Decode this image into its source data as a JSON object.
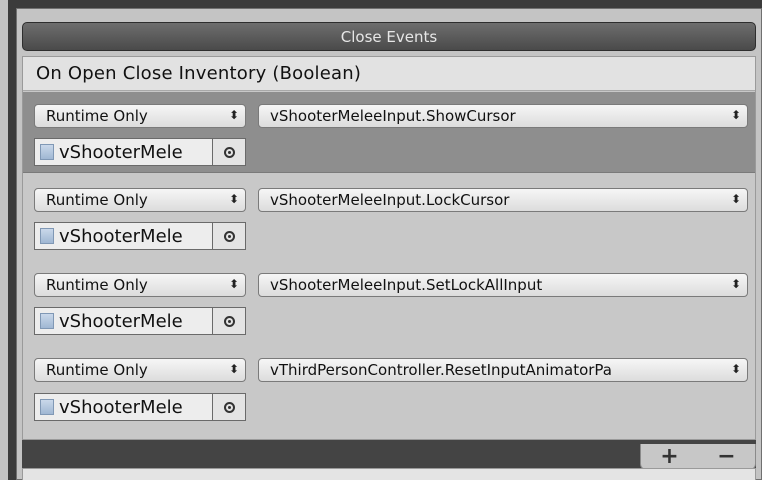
{
  "header": {
    "title": "Close Events"
  },
  "event": {
    "title": "On Open Close Inventory (Boolean)",
    "listeners": [
      {
        "mode": "Runtime Only",
        "function": "vShooterMeleeInput.ShowCursor",
        "target": "vShooterMele"
      },
      {
        "mode": "Runtime Only",
        "function": "vShooterMeleeInput.LockCursor",
        "target": "vShooterMele"
      },
      {
        "mode": "Runtime Only",
        "function": "vShooterMeleeInput.SetLockAllInput",
        "target": "vShooterMele"
      },
      {
        "mode": "Runtime Only",
        "function": "vThirdPersonController.ResetInputAnimatorPa",
        "target": "vShooterMele"
      }
    ]
  },
  "controls": {
    "add_label": "+",
    "remove_label": "−"
  },
  "icons": {
    "dropdown": "updown-arrow-icon",
    "object": "script-file-icon",
    "picker": "object-picker-icon"
  }
}
